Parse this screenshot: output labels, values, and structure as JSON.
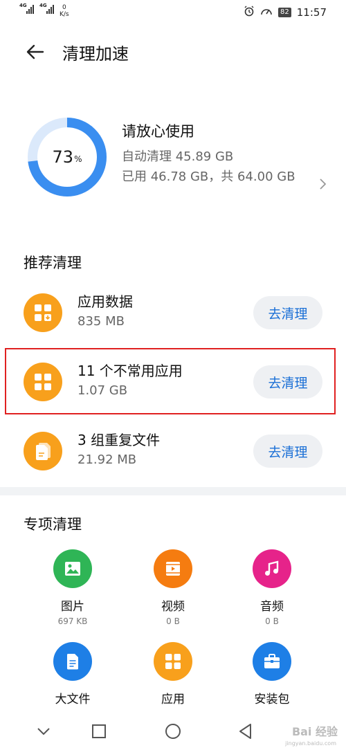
{
  "status_bar": {
    "sim1": "4G",
    "sim2": "4G",
    "net_speed_value": "0",
    "net_speed_unit": "K/s",
    "battery": "82",
    "time": "11:57"
  },
  "header": {
    "title": "清理加速"
  },
  "summary": {
    "percent": "73",
    "percent_unit": "%",
    "percent_value": 73,
    "title": "请放心使用",
    "auto_clean": "自动清理 45.89 GB",
    "used": "已用 46.78 GB，共 64.00 GB"
  },
  "recommend": {
    "title": "推荐清理",
    "button_label": "去清理",
    "items": [
      {
        "name": "应用数据",
        "size": "835 MB"
      },
      {
        "name": "11 个不常用应用",
        "size": "1.07 GB"
      },
      {
        "name": "3 组重复文件",
        "size": "21.92 MB"
      }
    ]
  },
  "special": {
    "title": "专项清理",
    "items": [
      {
        "label": "图片",
        "size": "697 KB",
        "color": "#2fb556",
        "icon": "image-icon"
      },
      {
        "label": "视频",
        "size": "0 B",
        "color": "#f57c10",
        "icon": "video-icon"
      },
      {
        "label": "音频",
        "size": "0 B",
        "color": "#e6238a",
        "icon": "music-icon"
      },
      {
        "label": "大文件",
        "color": "#1e7fe6",
        "icon": "document-icon"
      },
      {
        "label": "应用",
        "color": "#f8a01c",
        "icon": "apps-icon"
      },
      {
        "label": "安装包",
        "color": "#1e7fe6",
        "icon": "briefcase-icon"
      }
    ]
  },
  "watermark": {
    "text": "Bai 经验",
    "sub": "jingyan.baidu.com"
  },
  "colors": {
    "accent": "#1a6fd6",
    "donut": "#3a8ef0",
    "donut_track": "#dbe9fb",
    "highlight": "#e02020"
  }
}
